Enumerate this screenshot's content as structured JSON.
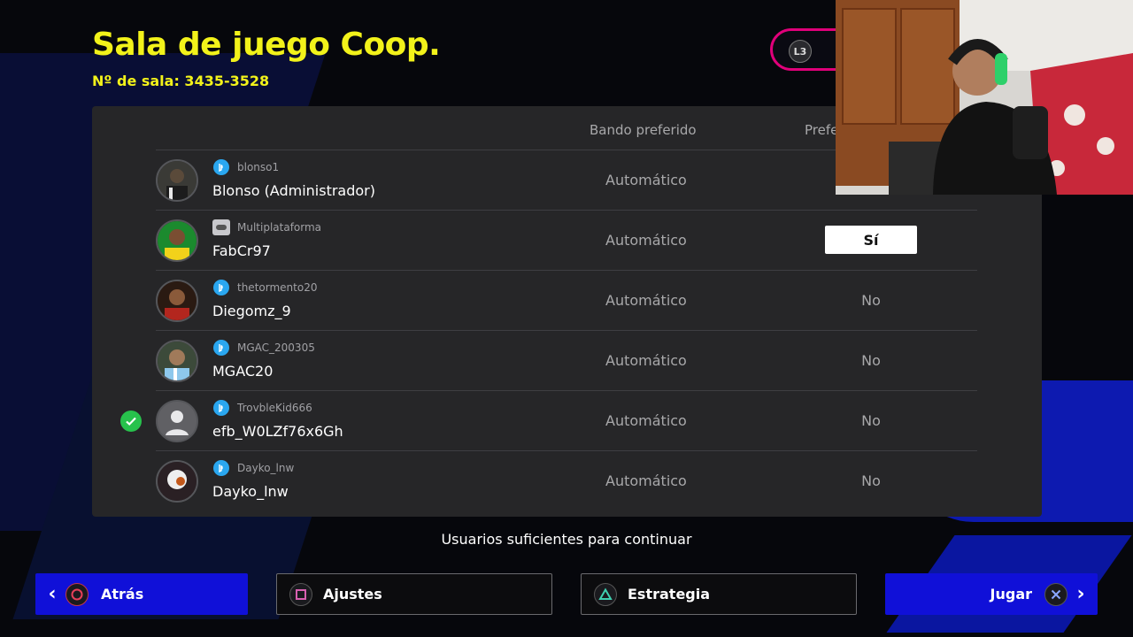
{
  "header": {
    "title": "Sala de juego Coop.",
    "room_number": "Nº de sala: 3435-3528",
    "l3_label": "L3"
  },
  "table": {
    "columns": {
      "side": "Bando preferido",
      "pref": "Prefe"
    },
    "rows": [
      {
        "platform": "ps-icon",
        "online_id": "blonso1",
        "name": "Blonso (Administrador)",
        "side": "Automático",
        "pref": "",
        "ready": false
      },
      {
        "platform": "gamepad-icon",
        "online_id": "Multiplataforma",
        "name": "FabCr97",
        "side": "Automático",
        "pref": "Sí",
        "pref_selected": true,
        "ready": false
      },
      {
        "platform": "ps-icon",
        "online_id": "thetormento20",
        "name": "Diegomz_9",
        "side": "Automático",
        "pref": "No",
        "ready": false
      },
      {
        "platform": "ps-icon",
        "online_id": "MGAC_200305",
        "name": "MGAC20",
        "side": "Automático",
        "pref": "No",
        "ready": false
      },
      {
        "platform": "ps-icon",
        "online_id": "TrovbleKid666",
        "name": "efb_W0LZf76x6Gh",
        "side": "Automático",
        "pref": "No",
        "ready": true
      },
      {
        "platform": "ps-icon",
        "online_id": "Dayko_lnw",
        "name": "Dayko_lnw",
        "side": "Automático",
        "pref": "No",
        "ready": false
      }
    ]
  },
  "status": {
    "message": "Usuarios suficientes para continuar"
  },
  "footer": {
    "back": "Atrás",
    "settings": "Ajustes",
    "strategy": "Estrategia",
    "play": "Jugar"
  },
  "colors": {
    "title": "#f2f21a",
    "panel": "#262628",
    "primary_button": "#1010d8",
    "ready_check": "#27c24c",
    "l3_border": "#e0007a"
  }
}
